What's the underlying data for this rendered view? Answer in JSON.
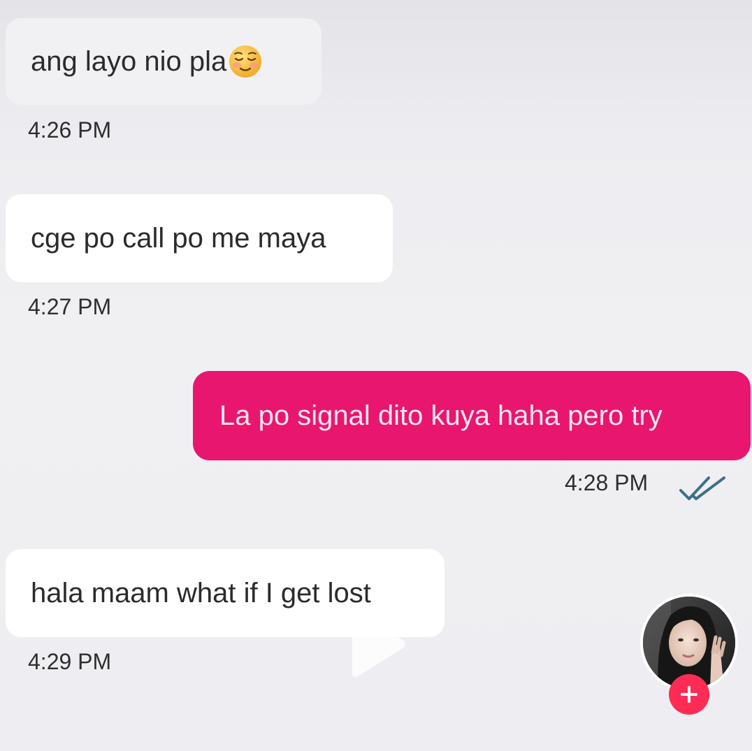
{
  "messages": [
    {
      "direction": "incoming",
      "text": "ang layo nio pla",
      "emoji": "relieved-face-emoji",
      "time": "4:26 PM"
    },
    {
      "direction": "incoming",
      "text": "cge po call po me maya",
      "time": "4:27 PM"
    },
    {
      "direction": "outgoing",
      "text": "La po signal dito kuya haha pero try",
      "time": "4:28 PM",
      "status_icon": "double-check-icon"
    },
    {
      "direction": "incoming",
      "text": "hala maam what if I get lost",
      "time": "4:29 PM"
    }
  ],
  "overlay": {
    "play_icon": "play-icon",
    "avatar": "profile-avatar",
    "follow_icon": "plus-icon"
  },
  "colors": {
    "outgoing_bubble": "#e8166e",
    "incoming_bubble": "#ffffff",
    "background": "#efeff2",
    "follow_button": "#fe2c55",
    "ticks": "#3d6f8a"
  }
}
